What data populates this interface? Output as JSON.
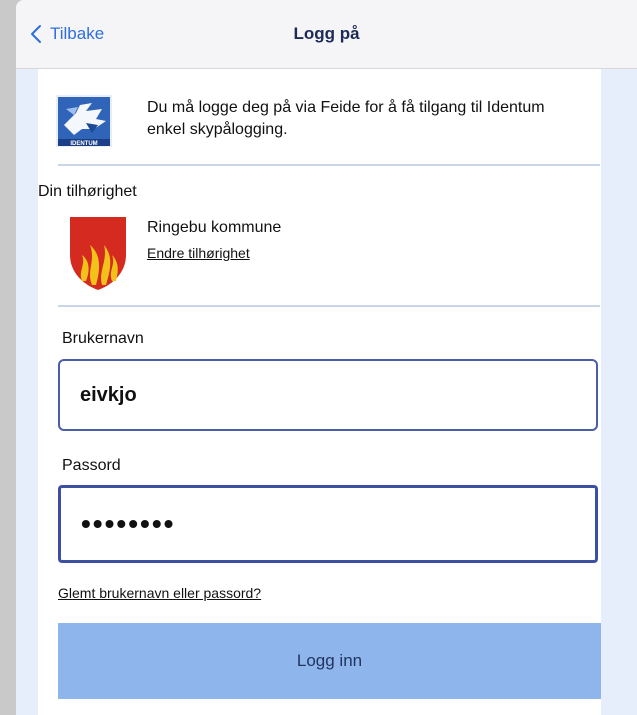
{
  "nav": {
    "back_label": "Tilbake",
    "title": "Logg på"
  },
  "intro": {
    "logo_text": "IDENTUM",
    "text": "Du må logge deg på via Feide for å få tilgang til Identum enkel skypålogging."
  },
  "affiliation": {
    "heading": "Din tilhørighet",
    "org_name": "Ringebu kommune",
    "change_link": "Endre tilhørighet"
  },
  "form": {
    "username_label": "Brukernavn",
    "username_value": "eivkjo",
    "password_label": "Passord",
    "password_value": "••••••••",
    "forgot_link": "Glemt brukernavn eller passord?",
    "submit_label": "Logg inn"
  },
  "colors": {
    "accent": "#2f6fdb",
    "button": "#8fb6ec",
    "background": "#e6eefb",
    "field_border": "#4a5ea8"
  }
}
